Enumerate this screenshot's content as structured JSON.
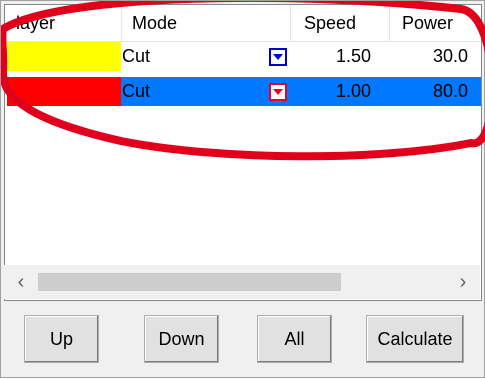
{
  "listview": {
    "columns": [
      "layer",
      "Mode",
      "Speed",
      "Power"
    ],
    "rows": [
      {
        "color": "#ffff00",
        "mode": "Cut",
        "speed": "1.50",
        "power": "30.0",
        "selected": false
      },
      {
        "color": "#ff0000",
        "mode": "Cut",
        "speed": "1.00",
        "power": "80.0",
        "selected": true
      }
    ],
    "scroll_left_icon": "‹",
    "scroll_right_icon": "›"
  },
  "buttons": {
    "up": "Up",
    "down": "Down",
    "all": "All",
    "calculate": "Calculate"
  },
  "colors": {
    "selection": "#0078ff",
    "annotation": "#e0001b",
    "dropdown_normal": "#0000cc",
    "dropdown_selected": "#e8002a"
  }
}
